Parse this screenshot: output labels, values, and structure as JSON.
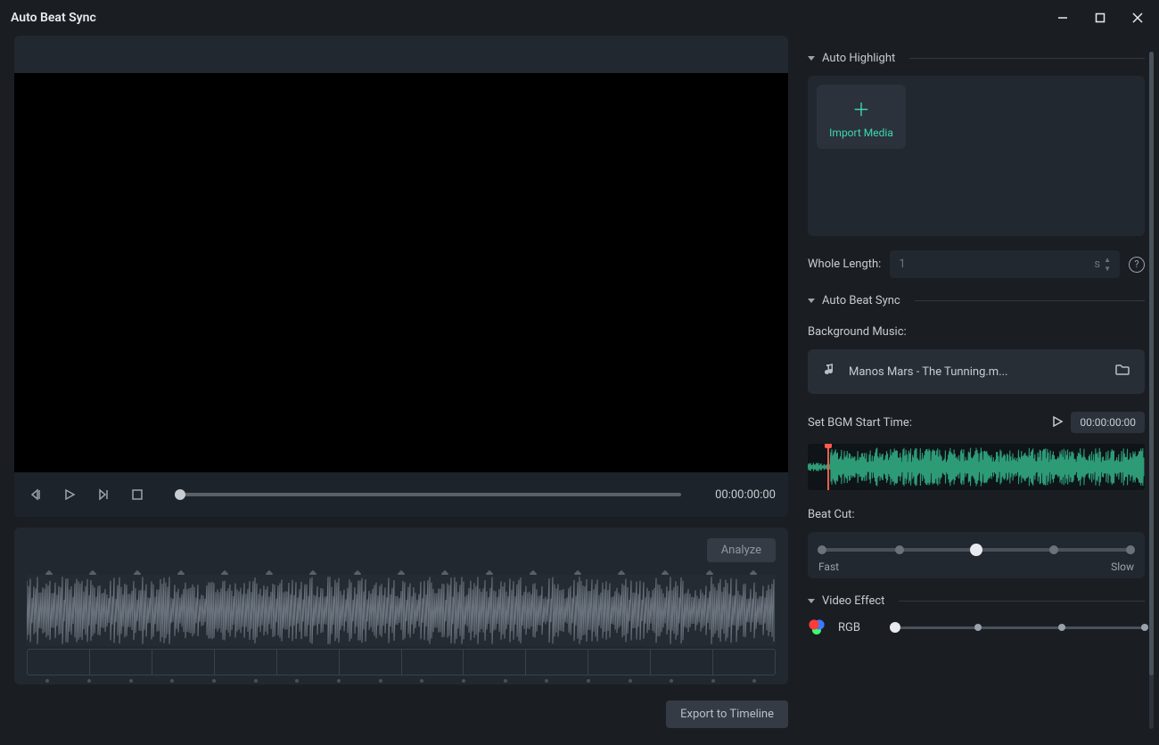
{
  "titlebar": {
    "title": "Auto Beat Sync"
  },
  "preview": {
    "time": "00:00:00:00"
  },
  "wavePanel": {
    "analyze": "Analyze",
    "segments": 12,
    "markers": 17,
    "ticks": 18
  },
  "export": {
    "label": "Export to Timeline"
  },
  "sections": {
    "autoHighlight": {
      "title": "Auto Highlight"
    },
    "autoBeatSync": {
      "title": "Auto Beat Sync"
    },
    "videoEffect": {
      "title": "Video Effect"
    }
  },
  "import": {
    "label": "Import Media"
  },
  "wholeLength": {
    "label": "Whole Length:",
    "value": "1",
    "unit": "s"
  },
  "bgm": {
    "label": "Background Music:",
    "track": "Manos Mars - The Tunning.m...",
    "startLabel": "Set BGM Start Time:",
    "startTime": "00:00:00:00"
  },
  "beatCut": {
    "label": "Beat Cut:",
    "fast": "Fast",
    "slow": "Slow",
    "stops": 5,
    "active": 2
  },
  "videoEffect": {
    "name": "RGB",
    "stops": 4,
    "active": 0
  }
}
